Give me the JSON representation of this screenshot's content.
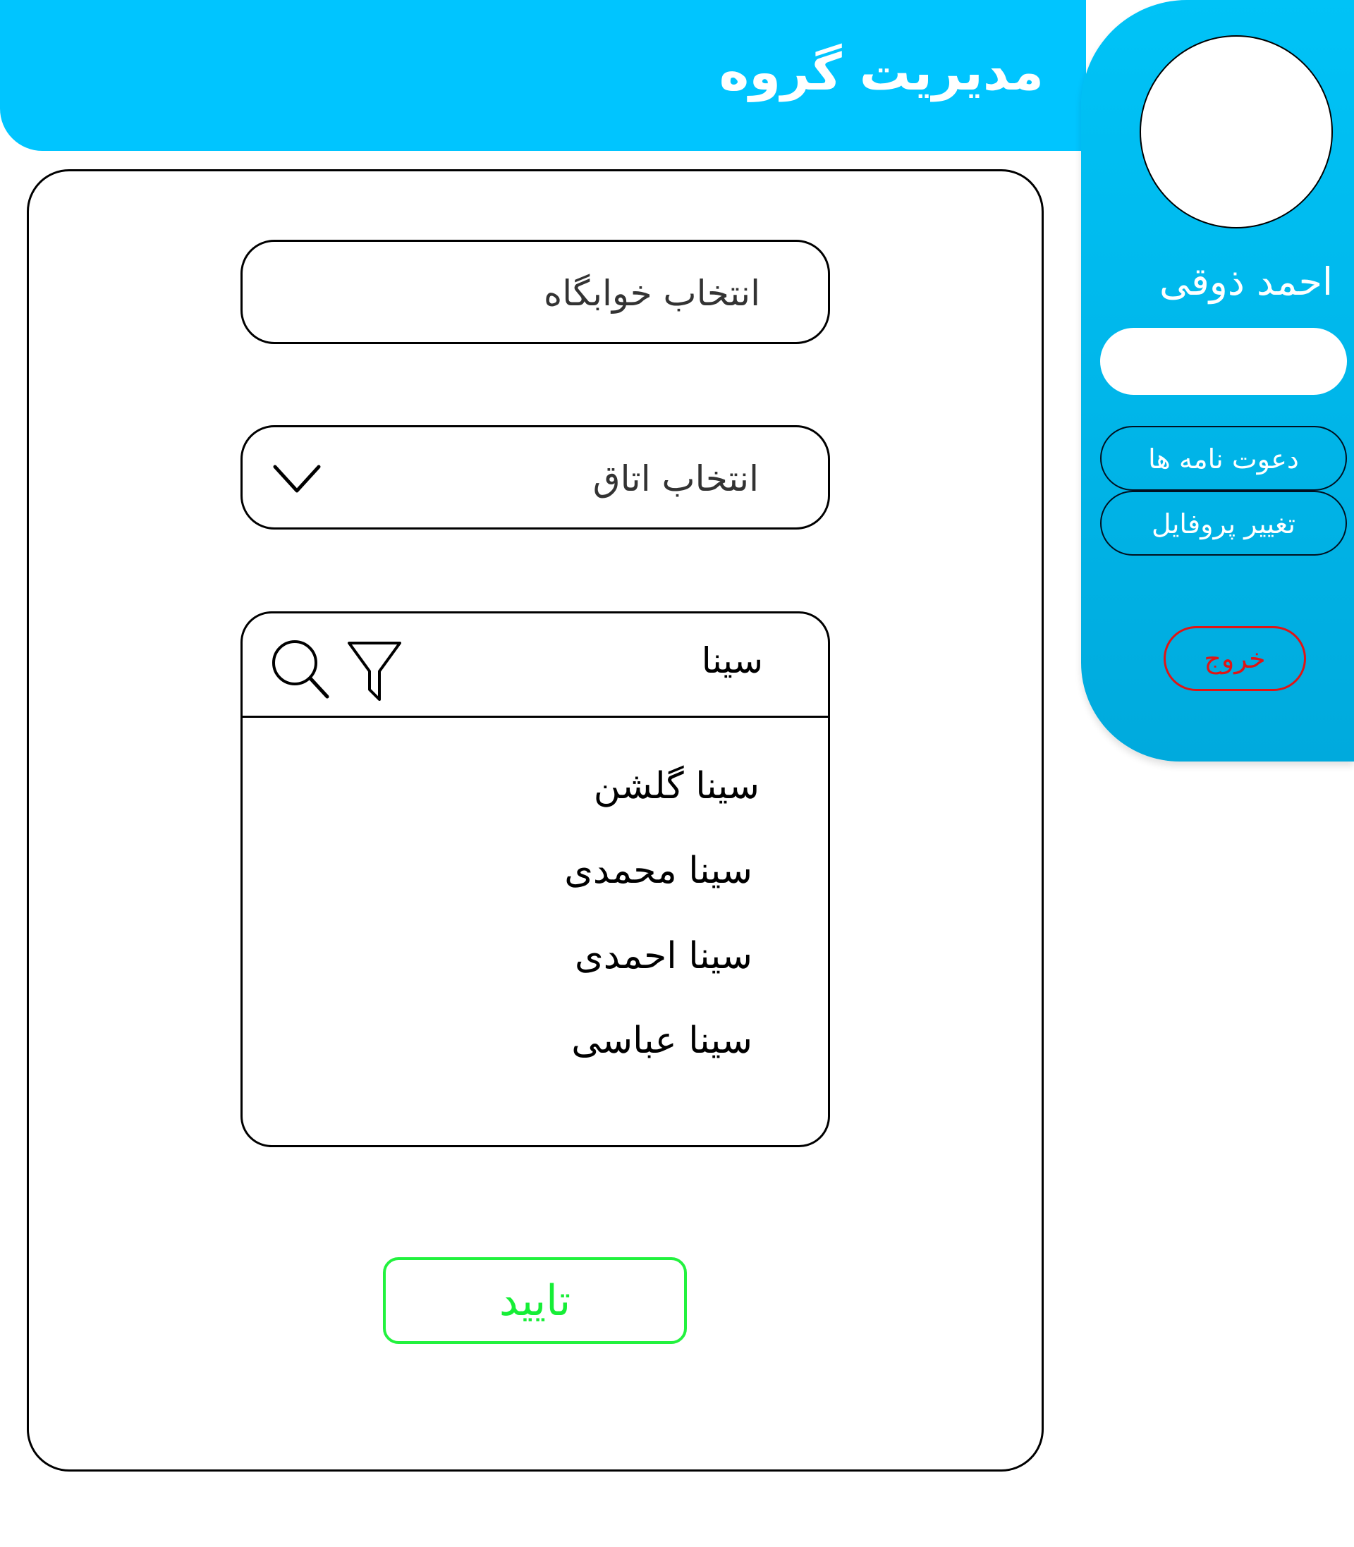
{
  "header": {
    "title": "مدیریت گروه"
  },
  "profile": {
    "name": "احمد ذوقی",
    "field_value": "",
    "invites_label": "دعوت نامه ها",
    "change_profile_label": "تغییر پروفایل",
    "logout_label": "خروج"
  },
  "form": {
    "dorm_select_label": "انتخاب خوابگاه",
    "room_select_label": "انتخاب اتاق",
    "search": {
      "value": "سینا",
      "results": [
        "سینا گلشن",
        "سینا محمدی",
        "سینا احمدی",
        "سینا عباسی"
      ]
    },
    "confirm_label": "تایید"
  },
  "icons": {
    "chevron": "chevron-down-icon",
    "search": "search-icon",
    "filter": "filter-icon"
  },
  "colors": {
    "header": "#00c5ff",
    "panel": "#00b4ea",
    "logout": "#e01515",
    "confirm": "#16ee36"
  }
}
